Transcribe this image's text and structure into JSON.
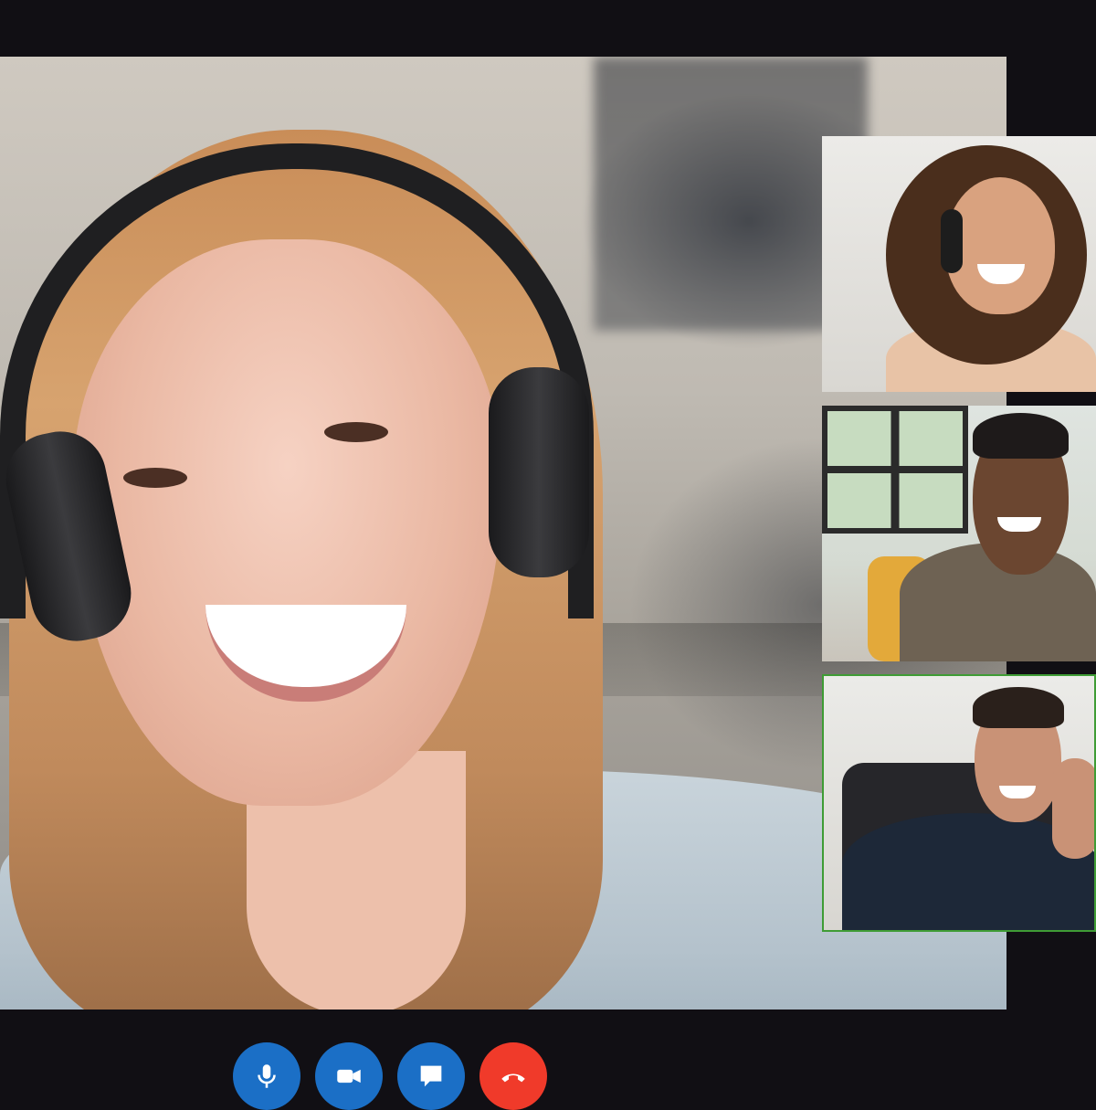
{
  "call": {
    "main_speaker": {
      "avatar": "woman-with-headphones"
    },
    "participants": [
      {
        "avatar": "woman-curly-hair-headphones",
        "active": false
      },
      {
        "avatar": "man-beard-smiling",
        "active": false
      },
      {
        "avatar": "man-waving-earphones",
        "active": true
      }
    ]
  },
  "controls": [
    {
      "icon": "microphone-icon",
      "color": "#1b6fc6"
    },
    {
      "icon": "video-camera-icon",
      "color": "#1b6fc6"
    },
    {
      "icon": "chat-bubble-icon",
      "color": "#1b6fc6"
    },
    {
      "icon": "hang-up-phone-icon",
      "color": "#f03a2a"
    }
  ],
  "colors": {
    "background": "#110f14",
    "accent_blue": "#1b6fc6",
    "end_call_red": "#f03a2a",
    "active_speaker_border": "#3f9c35"
  }
}
